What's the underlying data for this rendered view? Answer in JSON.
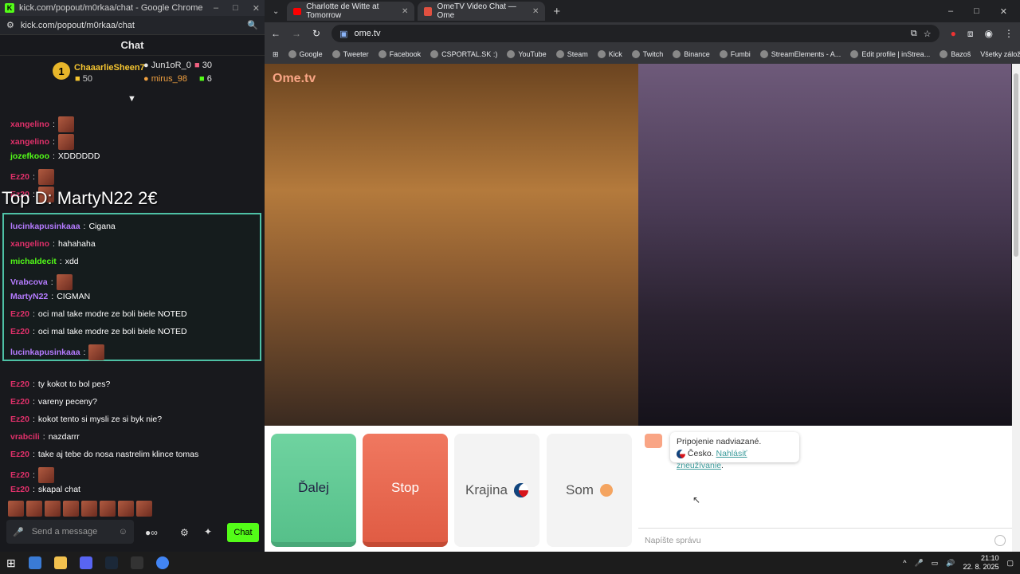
{
  "popup": {
    "window_title": "kick.com/popout/m0rkaa/chat - Google Chrome",
    "url": "kick.com/popout/m0rkaa/chat",
    "chat_title": "Chat",
    "leaderboard": {
      "first": {
        "rank": "1",
        "name": "ChaaarlieSheen7",
        "count": "50"
      },
      "second": {
        "name": "Jun1oR_0",
        "count": "30"
      },
      "third": {
        "name": "mirus_98",
        "count": "6"
      }
    },
    "overlay_text": "Top D:  MartyN22 2€",
    "messages": [
      {
        "user": "xangelino",
        "text": "",
        "color": "#e0306a"
      },
      {
        "user": "xangelino",
        "text": "",
        "color": "#e0306a"
      },
      {
        "user": "jozefkooo",
        "text": "XDDDDDD",
        "color": "#53fc18"
      },
      {
        "user": "Ez20",
        "text": "",
        "color": "#e0306a"
      },
      {
        "user": "Ez20",
        "text": "",
        "color": "#e0306a"
      },
      {
        "user": "lucinkapusinkaaa",
        "text": "Cigana",
        "color": "#b57bff"
      },
      {
        "user": "xangelino",
        "text": "hahahaha",
        "color": "#e0306a"
      },
      {
        "user": "michaldecit",
        "text": "xdd",
        "color": "#53fc18"
      },
      {
        "user": "Vrabcova",
        "text": "",
        "color": "#b57bff"
      },
      {
        "user": "MartyN22",
        "text": "CIGMAN",
        "color": "#b57bff"
      },
      {
        "user": "Ez20",
        "text": "oci mal take modre ze boli biele NOTED",
        "color": "#e0306a"
      },
      {
        "user": "Ez20",
        "text": "oci mal take modre ze boli biele NOTED",
        "color": "#e0306a"
      },
      {
        "user": "lucinkapusinkaaa",
        "text": "",
        "color": "#b57bff"
      },
      {
        "user": "Ez20",
        "text": "ty kokot to bol pes?",
        "color": "#e0306a"
      },
      {
        "user": "Ez20",
        "text": "vareny peceny?",
        "color": "#e0306a"
      },
      {
        "user": "Ez20",
        "text": "kokot tento si mysli ze si byk nie?",
        "color": "#e0306a"
      },
      {
        "user": "vrabcili",
        "text": "nazdarrr",
        "color": "#e0306a"
      },
      {
        "user": "Ez20",
        "text": "take aj tebe do nosa nastrelim klince tomas",
        "color": "#e0306a"
      },
      {
        "user": "Ez20",
        "text": "",
        "color": "#e0306a"
      },
      {
        "user": "Ez20",
        "text": "skapal chat",
        "color": "#e0306a"
      }
    ],
    "input_placeholder": "Send a message",
    "chat_button": "Chat",
    "accent": "#53fc18"
  },
  "browser": {
    "tabs": [
      {
        "title": "Charlotte de Witte at Tomorrow"
      },
      {
        "title": "OmeTV Video Chat — Ome"
      }
    ],
    "url": "ome.tv",
    "bookmarks": [
      "Google",
      "Tweeter",
      "Facebook",
      "CSPORTAL.SK :)",
      "YouTube",
      "Steam",
      "Kick",
      "Twitch",
      "Binance",
      "Fumbi",
      "StreamElements - A...",
      "Edit profile | inStrea...",
      "Bazoš"
    ],
    "all_bookmarks": "Všetky záložky"
  },
  "ometv": {
    "logo": "Ome.tv",
    "buttons": {
      "next": "Ďalej",
      "stop": "Stop",
      "country": "Krajina",
      "me": "Som"
    },
    "connected": "Pripojenie nadviazané.",
    "country_name": "Česko.",
    "report_link": "Nahlásiť zneužívanie",
    "report_suffix": ".",
    "message_placeholder": "Napíšte správu"
  },
  "taskbar": {
    "time": "21:10",
    "date": "22. 8. 2025"
  }
}
